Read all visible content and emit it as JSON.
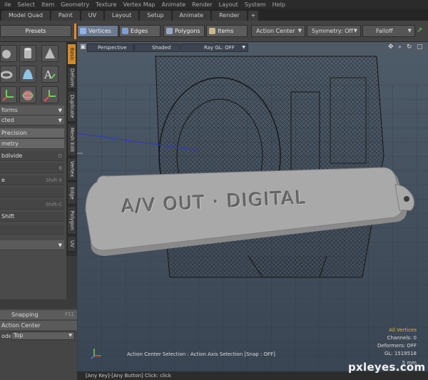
{
  "menubar": {
    "items": [
      "ile",
      "Select",
      "Item",
      "Geometry",
      "Texture",
      "Vertex Map",
      "Animate",
      "Render",
      "Layout",
      "System",
      "Help"
    ]
  },
  "layout_tabs": [
    "Model Quad",
    "Paint",
    "UV",
    "Layout",
    "Setup",
    "Animate",
    "Render",
    "+"
  ],
  "toolbar": {
    "presets": "Presets",
    "modes": [
      "Vertices",
      "Edges",
      "Polygons",
      "Items"
    ],
    "action_center": "Action Center",
    "symmetry": "Symmetry: Off",
    "falloff": "Falloff"
  },
  "left_panel": {
    "rows": [
      {
        "label": "forms",
        "kind": "dropdown"
      },
      {
        "label": "cted",
        "kind": "dropdown"
      },
      {
        "label": "Precision",
        "kind": "button"
      },
      {
        "label": "metry",
        "kind": "button"
      },
      {
        "label": "bdivide",
        "shortcut": "D"
      },
      {
        "label": "",
        "shortcut": "B"
      },
      {
        "label": "e",
        "shortcut": "Shift-X"
      },
      {
        "label": "",
        "shortcut": ""
      },
      {
        "label": "",
        "shortcut": "Shift-C"
      },
      {
        "label": "Shift",
        "shortcut": ""
      }
    ],
    "snapping": "Snapping",
    "snapping_shortcut": "F11",
    "action_center": "Action Center",
    "mode_label": "ode",
    "mode_value": "Top"
  },
  "vertical_tabs": [
    "Basic",
    "Deform",
    "Duplicate",
    "Mesh Edit",
    "Vertex",
    "Edge",
    "Polygon",
    "UV"
  ],
  "viewport": {
    "view": "Perspective",
    "shading": "Shaded",
    "raygl": "Ray GL: OFF",
    "model_text": "A/V OUT · DIGITAL",
    "overlay": "Action Center Selection : Action Axis Selection  [Snap : OFF]",
    "stats": {
      "header": "All Vertices",
      "channels": "Channels: 0",
      "deformers": "Deformers: OFF",
      "gl": "GL: 1519518",
      "scale": "5 mm"
    },
    "accent": "#d28a28"
  },
  "statusbar": "[Any Key]-[Any Button] Click:  click",
  "watermark": "pxleyes.com"
}
